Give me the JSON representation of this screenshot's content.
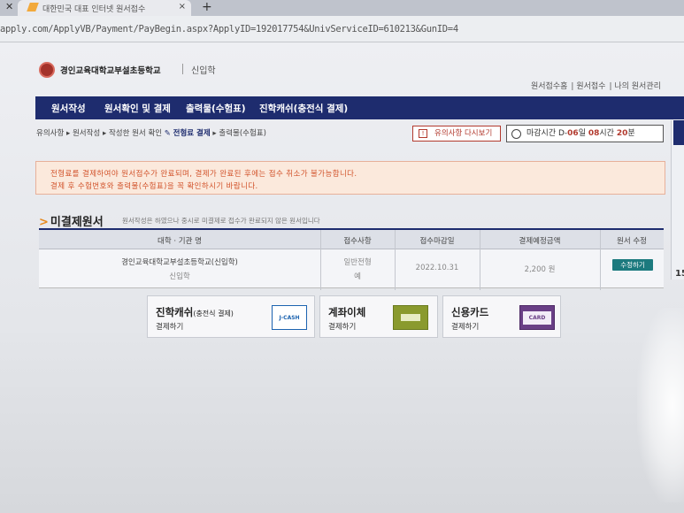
{
  "browser": {
    "close_icon": "close-icon",
    "tab_title": "대한민국 대표 인터넷 원서접수",
    "tab_close": "×",
    "new_tab": "+",
    "url": "apply.com/ApplyVB/Payment/PayBegin.aspx?ApplyID=192017754&UnivServiceID=610213&GunID=4"
  },
  "header": {
    "school_name": "경인교육대학교부설초등학교",
    "dept": "신입학",
    "top_links": [
      "원서접수홈",
      "원서접수",
      "나의 원서관리"
    ]
  },
  "nav": {
    "items": [
      "원서작성",
      "원서확인 및 결제",
      "출력물(수험표)",
      "진학캐쉬(충전식 결제)"
    ]
  },
  "breadcrumb": {
    "steps": [
      "유의사항",
      "원서작성",
      "작성한 원서 확인",
      "전형료 결제",
      "출력물(수험표)"
    ],
    "sep": "▸"
  },
  "actions": {
    "notice_label": "유의사항 다시보기",
    "deadline_label": "마감시간 D-",
    "deadline_days": "06",
    "deadline_days_unit": "일",
    "deadline_hours": "08",
    "deadline_hours_unit": "시간",
    "deadline_minutes": "20",
    "deadline_minutes_unit": "분"
  },
  "alert": {
    "line1": "전형료를 결제하여야 원서접수가 완료되며, 결제가 완료된 후에는 접수 취소가 불가능합니다.",
    "line2": "결제 후 수험번호와 출력물(수험표)을 꼭 확인하시기 바랍니다."
  },
  "section": {
    "title": "미결제원서",
    "desc": "원서작성은 하였으나 중시로 미결제로 접수가 완료되지 않은 원서입니다"
  },
  "table": {
    "headers": [
      "대학 · 기관 명",
      "접수사항",
      "접수마감일",
      "결제예정금액",
      "원서 수정"
    ],
    "row": {
      "school": "경인교육대학교부설초등학교(신입학)",
      "sub": "신입학",
      "type_line1": "일반전형",
      "type_line2": "예",
      "deadline": "2022.10.31",
      "amount": "2,200 원",
      "edit_label": "수정하기"
    }
  },
  "payment": [
    {
      "title": "진학캐쉬",
      "title_small": "(충전식 결제)",
      "sub": "결제하기",
      "icon_text": "J-CASH"
    },
    {
      "title": "계좌이체",
      "title_small": "",
      "sub": "결제하기",
      "icon_text": ""
    },
    {
      "title": "신용카드",
      "title_small": "",
      "sub": "결제하기",
      "icon_text": "CARD"
    }
  ],
  "side": {
    "number": "15"
  },
  "colors": {
    "nav_bg": "#1e2c6e",
    "alert_text": "#d2542c",
    "edit_btn": "#1c7a7e",
    "card_purple": "#6a3f86",
    "transfer_green": "#8a9a2e"
  }
}
